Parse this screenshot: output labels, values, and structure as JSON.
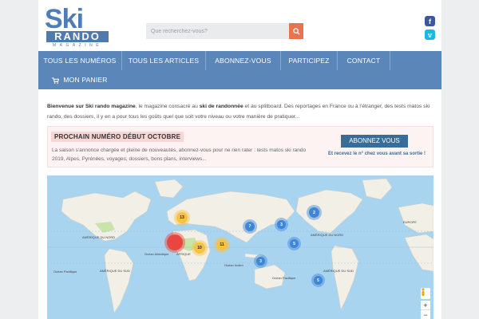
{
  "logo": {
    "ski": "Ski",
    "rando": "RANDO",
    "magazine": "MAGAZINE"
  },
  "search": {
    "placeholder": "Que recherchez-vous?",
    "value": ""
  },
  "social": [
    {
      "name": "facebook",
      "glyph": "f",
      "color": "#3b5998"
    },
    {
      "name": "vimeo",
      "glyph": "v",
      "color": "#1ab7ea"
    }
  ],
  "nav": {
    "items": [
      "TOUS LES NUMÉROS",
      "TOUS LES ARTICLES",
      "ABONNEZ-VOUS",
      "PARTICIPEZ",
      "CONTACT"
    ],
    "cart": "MON PANIER"
  },
  "intro": {
    "p1": "Bienvenue sur Ski rando magazine",
    "p2": ", le magazine consacré au ",
    "p3": "ski de randonnée",
    "p4": " et au splitboard. Des reportages en France ou à l'étranger, des tests matos ski rando, des dossiers, il y en a pour tous les goûts quel que soit votre niveau ou votre manière de pratiquer..."
  },
  "promo": {
    "title": "PROCHAIN NUMÉRO DÉBUT OCTOBRE",
    "text": "La saison s'annonce chargée et pleine de nouveautés, abonnez-vous pour ne rien rater : tests matos ski rando 2019, Alpes, Pyrénées, voyages, dossiers, bons plans, interviews...",
    "button": "ABONNEZ VOUS",
    "note": "Et recevez le n° chez vous avant sa sortie !"
  },
  "map": {
    "clusters": [
      {
        "label": "13",
        "kind": "yellow"
      },
      {
        "label": "10",
        "kind": "yellow"
      },
      {
        "label": "11",
        "kind": "yellow"
      },
      {
        "label": "",
        "kind": "red"
      },
      {
        "label": "7",
        "kind": "blue"
      },
      {
        "label": "3",
        "kind": "blue"
      },
      {
        "label": "2",
        "kind": "blue"
      },
      {
        "label": "5",
        "kind": "blue"
      },
      {
        "label": "5",
        "kind": "blue"
      },
      {
        "label": "3",
        "kind": "blue"
      }
    ],
    "labels": [
      "AMÉRIQUE DU NORD",
      "AFRIQUE",
      "AMÉRIQUE DU SUD",
      "AMÉRIQUE DU NORD",
      "EUROPE",
      "AMÉRIQUE DU SUD",
      "Océan Atlantique",
      "Océan Pacifique",
      "Océan Indien",
      "Océan Pacifique"
    ],
    "zoom_in": "+",
    "zoom_out": "−"
  }
}
